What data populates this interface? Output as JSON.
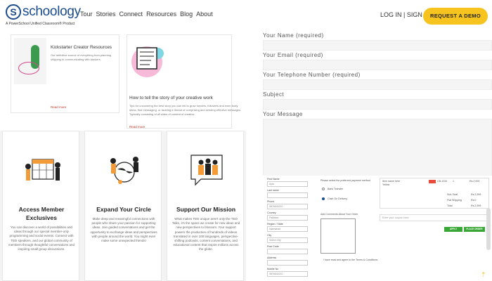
{
  "header": {
    "logo_mark": "S",
    "logo_word": "schoology",
    "logo_sub": "A PowerSchool Unified Classroom® Product",
    "nav": [
      "Tour",
      "Stories",
      "Connect",
      "Resources",
      "Blog",
      "About"
    ],
    "login": "LOG IN | SIGN UP",
    "cta": "REQUEST A DEMO"
  },
  "blog": {
    "card1": {
      "title": "Kickstarter Creator Resources",
      "text": "Our definitive source of everything from planning shipping to communicating with backers.",
      "more": "Read more"
    },
    "card2": {
      "title": "How to tell the story of your creative work",
      "text": "Tips for uncovering the best story you can tell to grow funders, followers and even body ideas, find messaging, or tackling a thread of comprising and sending effective messages. Typically consisting of all sides of content of creative.",
      "more": "Read more"
    }
  },
  "features": [
    {
      "title_line1": "Access Member",
      "title_line2": "Exclusives",
      "desc": "You can discover a world of possibilities and ideas through our special member-only programming and social events. Connect with TED speakers, and our global community of members through thoughtful conversations and inspiring small group discussions."
    },
    {
      "title_line1": "Expand Your Circle",
      "desc": "Make deep and meaningful connections with people who share your passion for supporting ideas. Join guided conversations and get the opportunity to exchange ideas and perspectives with people around the world. You might even make some unexpected friends!"
    },
    {
      "title_line1": "Support Our Mission",
      "desc": "What makes TED unique aren't only the TED Talks, it's the space we create for new ideas and new perspectives to blossom. Your support powers the production of hundreds of videos translated in over 100 languages, perspective-shifting podcasts, content conversations, and educational content that inspire millions across the globe."
    }
  ],
  "form": {
    "labels": [
      "Your Name (required)",
      "Your Email (required)",
      "Your Telephone Number (required)",
      "Subject",
      "Your Message"
    ]
  },
  "checkout": {
    "left_labels": [
      "First Name",
      "Last name",
      "Phone",
      "Country",
      "Region / State",
      "City",
      "Post Code",
      "Address",
      "Mobile No"
    ],
    "left_values": [
      "Ayla",
      "",
      "5876543210",
      "Pakistan",
      "Islamabad",
      "Select City",
      "",
      "",
      "9876543210"
    ],
    "mid_title": "Please select the preferred payment method",
    "mid_options": [
      "Bank Transfer",
      "Cash On Delivery"
    ],
    "mid_comments_label": "Add Comments About Your Order",
    "mid_checkbox_label": "I have read and agree to the Terms & Conditions",
    "right_item_name": "Item name here",
    "right_item_sub": "Yellow",
    "right_item_code": "CB-1234",
    "right_item_qty": "1",
    "right_item_price": "Rs.2,000",
    "right_rows": [
      {
        "label": "Sub-Total",
        "value": "Rs.2,999"
      },
      {
        "label": "Flat Shipping",
        "value": "Rs.0"
      },
      {
        "label": "Total",
        "value": "Rs.2,999"
      }
    ],
    "coupon_placeholder": "Enter your coupon here",
    "coupon_button": "APPLY",
    "place_button": "PLACE ORDER"
  }
}
